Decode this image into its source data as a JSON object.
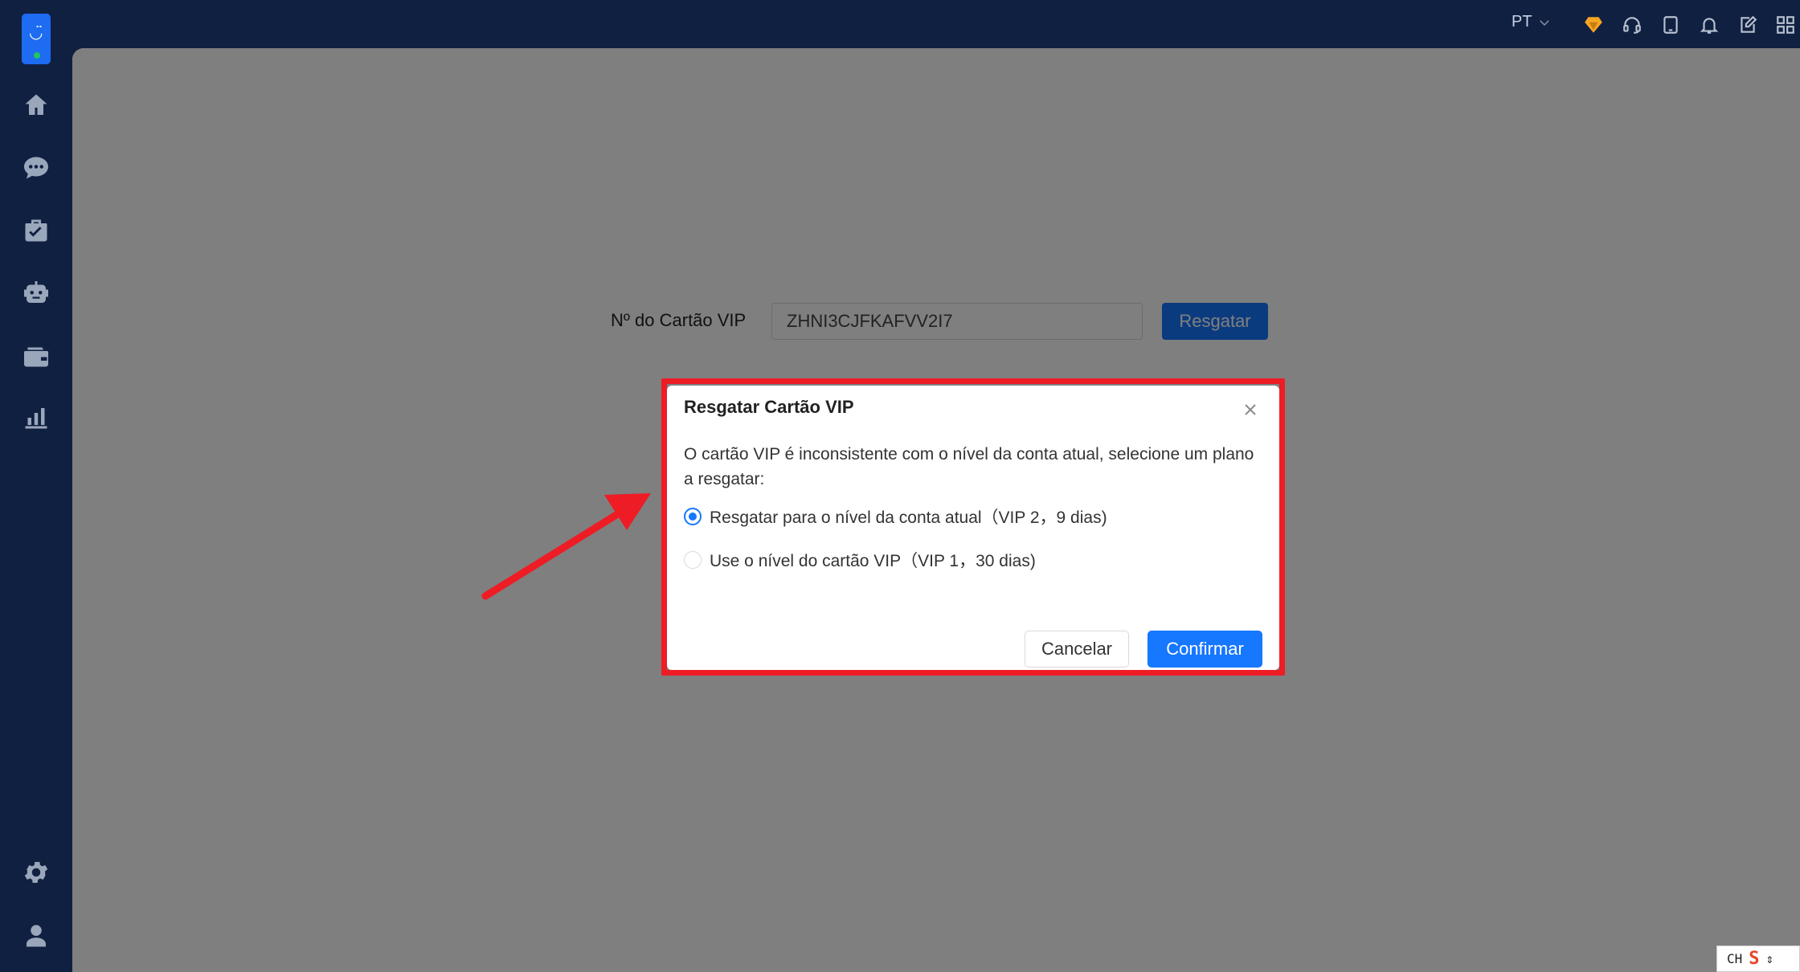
{
  "topbar": {
    "language": "PT"
  },
  "icons": {
    "logo": "smiley-logo",
    "nav": [
      "home-icon",
      "chat-icon",
      "briefcase-check-icon",
      "robot-icon",
      "wallet-icon",
      "bar-chart-icon",
      "settings-icon",
      "user-icon"
    ],
    "top": [
      "diamond-icon",
      "headset-icon",
      "tablet-icon",
      "bell-icon",
      "edit-icon",
      "apps-icon"
    ]
  },
  "main": {
    "card_label": "Nº do Cartão VIP",
    "card_value": "ZHNI3CJFKAFVV2I7",
    "redeem_button": "Resgatar"
  },
  "modal": {
    "title": "Resgatar Cartão VIP",
    "message": "O cartão VIP é inconsistente com o nível da conta atual, selecione um plano a resgatar:",
    "options": [
      {
        "label": "Resgatar para o nível da conta atual（VIP 2，9 dias)",
        "checked": true
      },
      {
        "label": "Use o nível do cartão VIP（VIP 1，30 dias)",
        "checked": false
      }
    ],
    "cancel": "Cancelar",
    "confirm": "Confirmar"
  },
  "ime": {
    "text": "CH"
  },
  "colors": {
    "primary": "#1677ff",
    "sidebar": "#102041",
    "annotation": "#ee1c25",
    "diamond": "#f5a623"
  }
}
